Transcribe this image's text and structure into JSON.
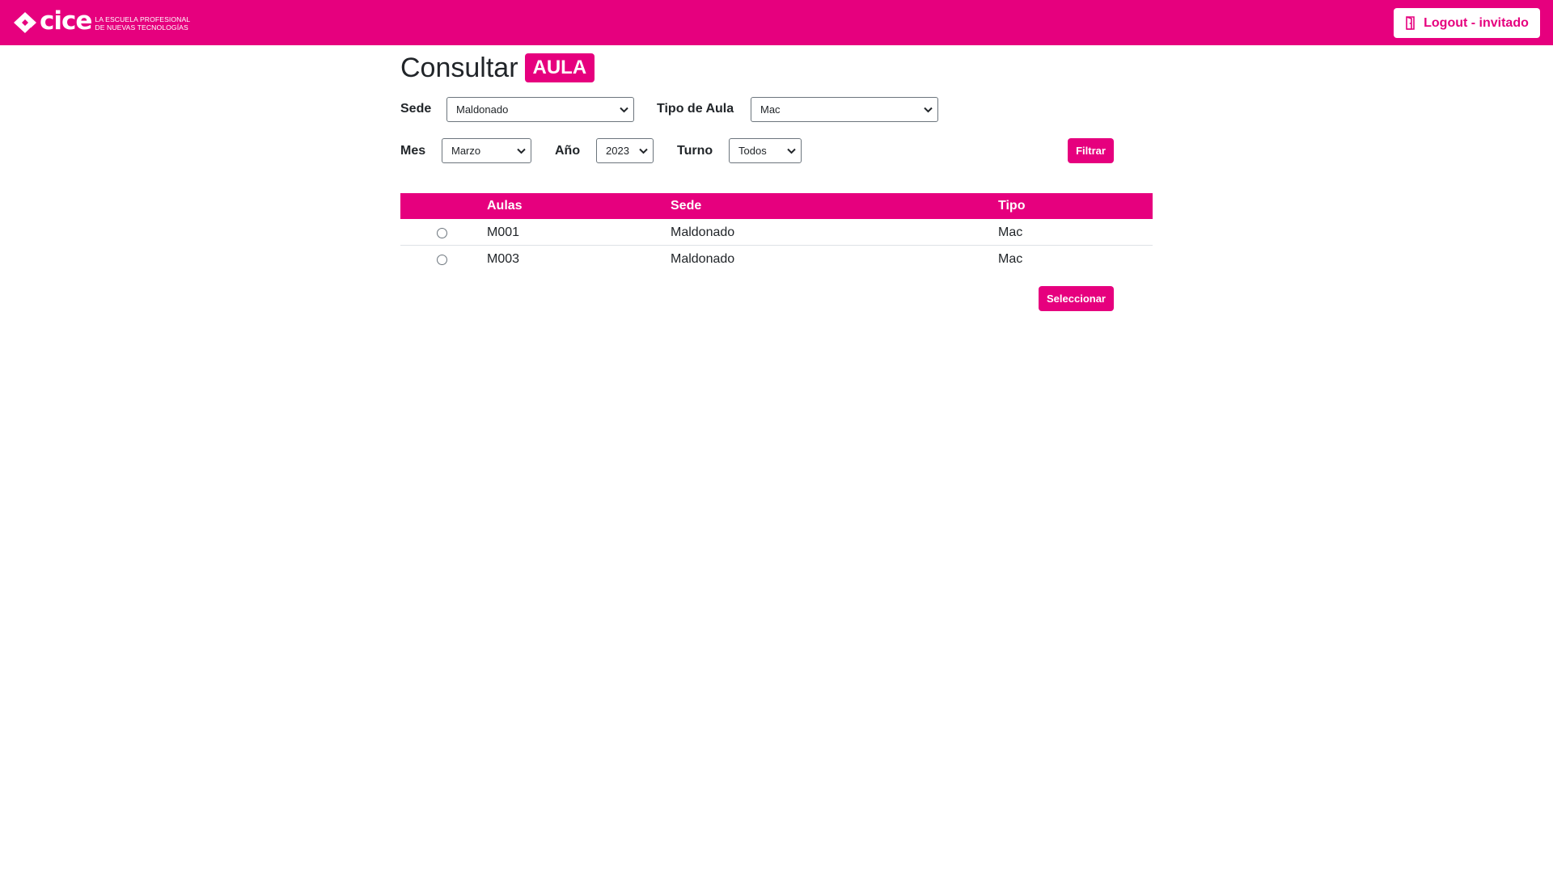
{
  "header": {
    "brand_name": "cice",
    "brand_tagline_1": "LA ESCUELA PROFESIONAL",
    "brand_tagline_2": "DE NUEVAS TECNOLOGÍAS",
    "logout_label": "Logout - invitado",
    "accent_color": "#e6007e"
  },
  "page": {
    "title": "Consultar",
    "badge": "AULA"
  },
  "filters": {
    "sede_label": "Sede",
    "sede_value": "Maldonado",
    "tipo_label": "Tipo de Aula",
    "tipo_value": "Mac",
    "mes_label": "Mes",
    "mes_value": "Marzo",
    "anio_label": "Año",
    "anio_value": "2023",
    "turno_label": "Turno",
    "turno_value": "Todos",
    "filter_button": "Filtrar"
  },
  "table": {
    "columns": [
      "Aulas",
      "Sede",
      "Tipo"
    ],
    "rows": [
      {
        "aula": "M001",
        "sede": "Maldonado",
        "tipo": "Mac",
        "selected": false
      },
      {
        "aula": "M003",
        "sede": "Maldonado",
        "tipo": "Mac",
        "selected": false
      }
    ]
  },
  "select_button": "Seleccionar"
}
